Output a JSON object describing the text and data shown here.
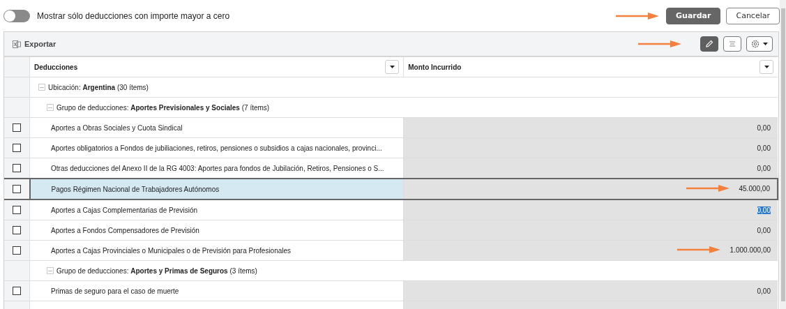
{
  "filter_toggle": {
    "on": false,
    "label": "Mostrar sólo deducciones con importe mayor a cero"
  },
  "buttons": [
    {
      "label": "Guardar",
      "kind": "primary",
      "annotated": true
    },
    {
      "label": "Cancelar",
      "kind": "secondary",
      "annotated": false
    }
  ],
  "toolbar": {
    "export_label": "Exportar",
    "edit_active": true,
    "edit_annotated": true
  },
  "table": {
    "columns": [
      "Deducciones",
      "Monto Incurrido"
    ],
    "groups": [
      {
        "label": "Ubicación: ",
        "name": "Argentina",
        "count": "(30 ítems)",
        "expanded": true,
        "children": [
          {
            "label": "Grupo de deducciones: ",
            "name": "Aportes Previsionales y Sociales",
            "count": "(7 ítems)",
            "expanded": true,
            "rows": [
              {
                "text": "Aportes a Obras Sociales y Cuota Sindical",
                "amount": "0,00",
                "checked": false,
                "selected": false,
                "amount_highlighted": false,
                "annotated": false
              },
              {
                "text": "Aportes obligatorios a Fondos de jubiliaciones, retiros, pensiones o subsidios a cajas nacionales, provinci...",
                "amount": "0,00",
                "checked": false,
                "selected": false,
                "amount_highlighted": false,
                "annotated": false
              },
              {
                "text": "Otras deducciones del Anexo II de la RG 4003: Aportes para fondos de Jubilación, Retiros, Pensiones o S...",
                "amount": "0,00",
                "checked": false,
                "selected": false,
                "amount_highlighted": false,
                "annotated": false
              },
              {
                "text": "Pagos Régimen Nacional de Trabajadores Autónomos",
                "amount": "45.000,00",
                "checked": false,
                "selected": true,
                "amount_highlighted": false,
                "annotated": true
              },
              {
                "text": "Aportes a Cajas Complementarias de Previsión",
                "amount": "0,00",
                "checked": false,
                "selected": false,
                "amount_highlighted": true,
                "annotated": false
              },
              {
                "text": "Aportes a Fondos Compensadores de Previsión",
                "amount": "0,00",
                "checked": false,
                "selected": false,
                "amount_highlighted": false,
                "annotated": false
              },
              {
                "text": "Aportes a Cajas Provinciales o Municipales o de Previsión para Profesionales",
                "amount": "1.000.000,00",
                "checked": false,
                "selected": false,
                "amount_highlighted": false,
                "annotated": true
              }
            ]
          },
          {
            "label": "Grupo de deducciones: ",
            "name": "Aportes y Primas de Seguros",
            "count": "(3 ítems)",
            "expanded": true,
            "rows": [
              {
                "text": "Primas de seguro para el caso de muerte",
                "amount": "0,00",
                "checked": false,
                "selected": false,
                "amount_highlighted": false,
                "annotated": false
              }
            ]
          }
        ]
      }
    ]
  }
}
